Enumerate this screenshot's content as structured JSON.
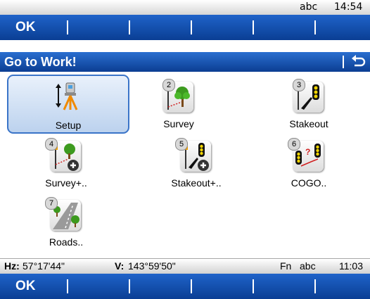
{
  "status_top": {
    "mode": "abc",
    "time": "14:54"
  },
  "fn_keys_top": [
    "OK",
    "",
    "",
    "",
    "",
    ""
  ],
  "title": "Go to Work!",
  "tiles": [
    {
      "num": "",
      "label": "Setup",
      "selected": true,
      "icon": "setup-tripod-icon"
    },
    {
      "num": "2",
      "label": "Survey",
      "icon": "survey-icon"
    },
    {
      "num": "3",
      "label": "Stakeout",
      "icon": "stakeout-icon"
    },
    {
      "num": "4",
      "label": "Survey+..",
      "icon": "survey-plus-icon"
    },
    {
      "num": "5",
      "label": "Stakeout+..",
      "icon": "stakeout-plus-icon"
    },
    {
      "num": "6",
      "label": "COGO..",
      "icon": "cogo-icon"
    },
    {
      "num": "7",
      "label": "Roads..",
      "icon": "roads-icon"
    }
  ],
  "status_bottom": {
    "hz_label": "Hz:",
    "hz_value": "57°17'44\"",
    "v_label": "V:",
    "v_value": "143°59'50\"",
    "fn": "Fn",
    "mode": "abc",
    "time": "11:03"
  },
  "fn_keys_bottom": [
    "OK",
    "",
    "",
    "",
    "",
    ""
  ],
  "colors": {
    "bar_blue": "#0a3e94",
    "selection": "#3a74c8",
    "tree_green": "#3c9a1e",
    "signal_yellow": "#f0d400"
  }
}
